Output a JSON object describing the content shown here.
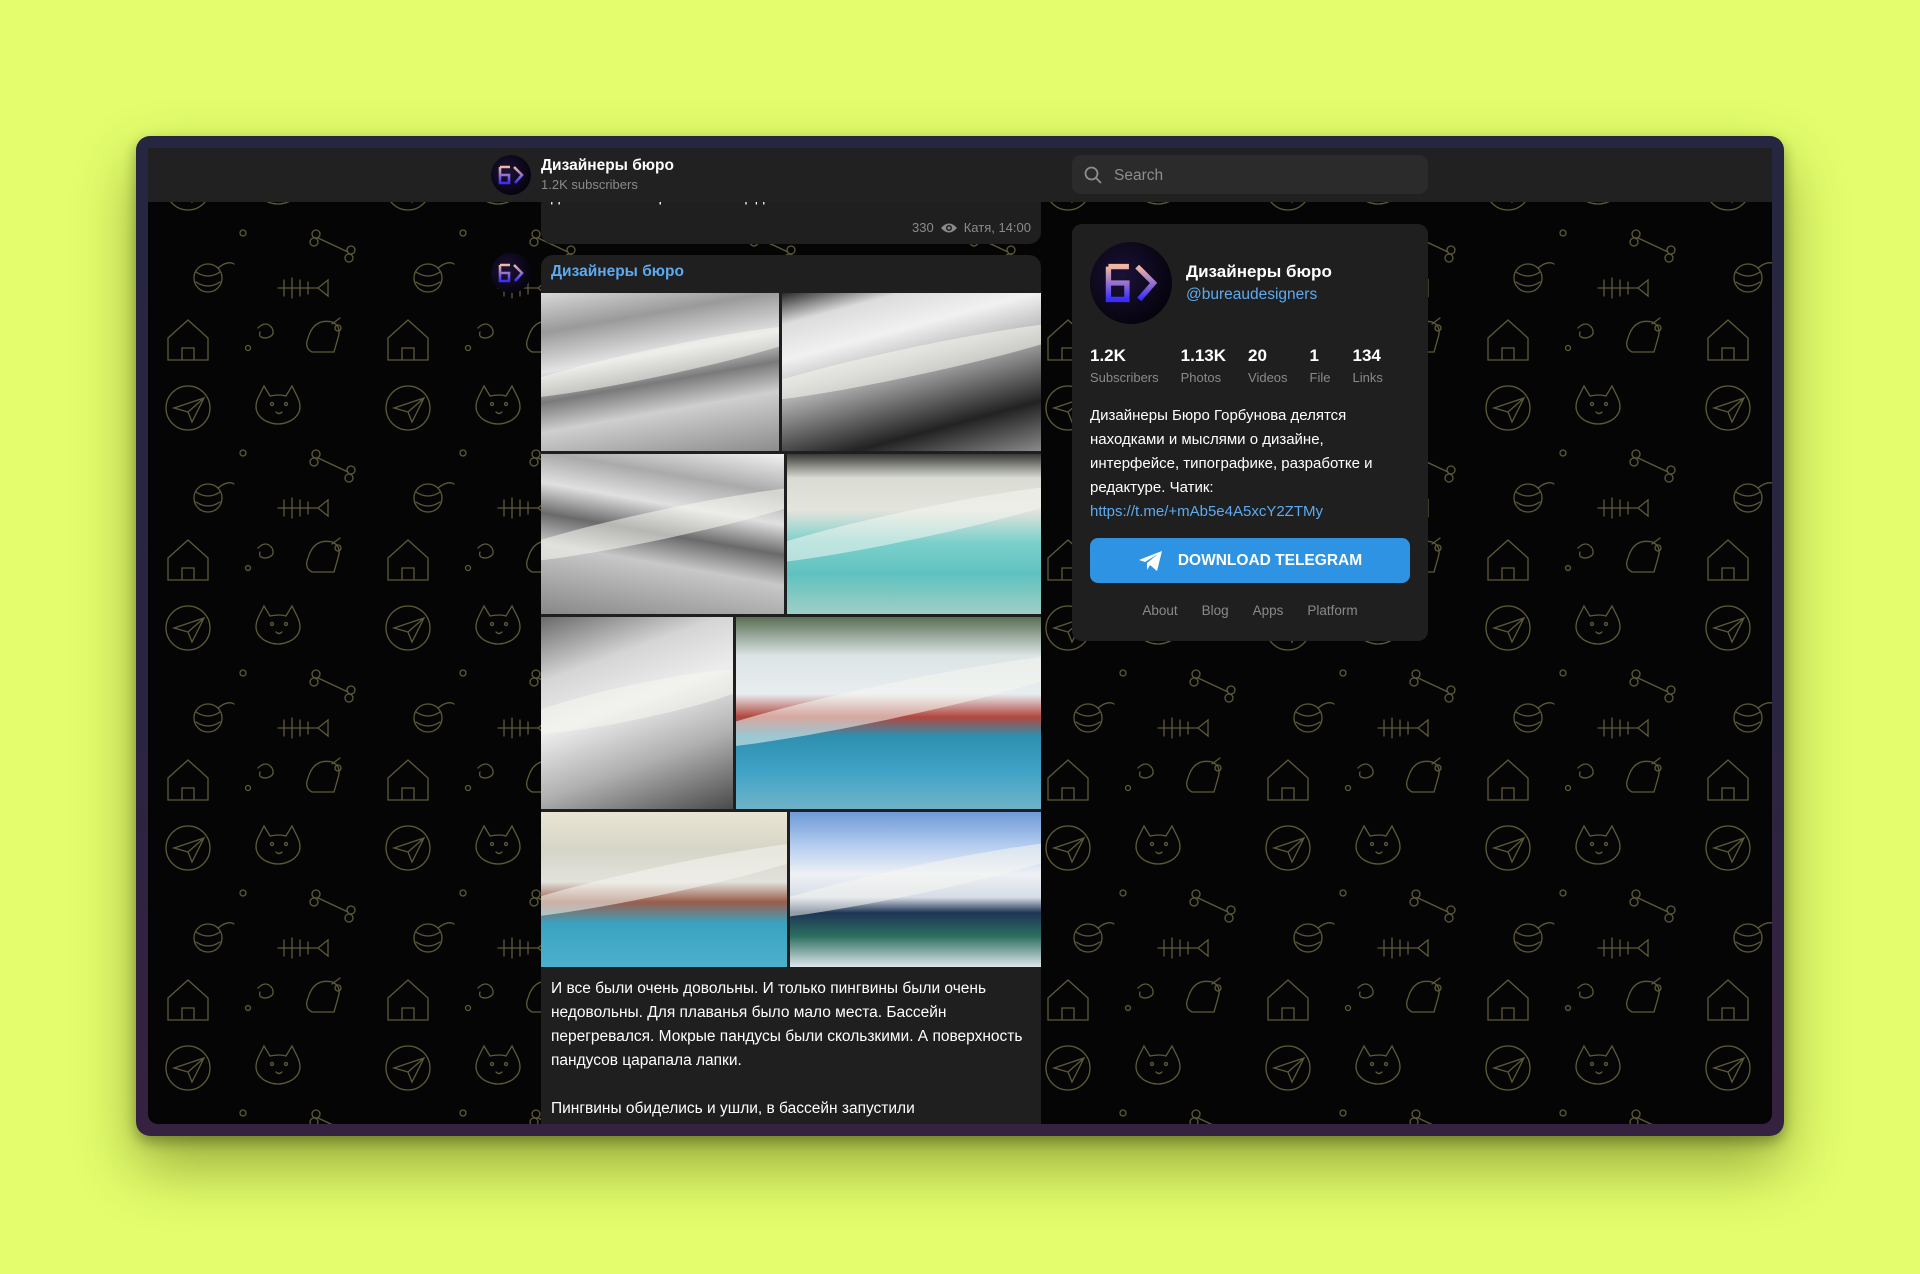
{
  "header": {
    "channel_name": "Дизайнеры бюро",
    "subscribers": "1.2K subscribers",
    "search_placeholder": "Search"
  },
  "previous_message": {
    "text": "добавили смотровые площадки.",
    "views": "330",
    "signature": "Катя, 14:00"
  },
  "message": {
    "author": "Дизайнеры бюро",
    "photos": [
      {
        "label": "penguin-pool-bw-1"
      },
      {
        "label": "penguin-pool-bw-2"
      },
      {
        "label": "penguin-pool-bw-3"
      },
      {
        "label": "penguin-pool-color-1"
      },
      {
        "label": "penguin-pool-bw-4"
      },
      {
        "label": "fashion-shoot-1"
      },
      {
        "label": "fashion-shoot-2"
      },
      {
        "label": "pool-render"
      }
    ],
    "paragraphs": [
      "И все были очень довольны. И только пингвины были очень недовольны. Для плаванья было мало места. Бассейн перегревался. Мокрые пандусы были скользкими. А поверхность пандусов царапала лапки.",
      "Пингвины обиделись и ушли, в бассейн запустили"
    ]
  },
  "channel_panel": {
    "title": "Дизайнеры бюро",
    "username": "@bureaudesigners",
    "stats": [
      {
        "value": "1.2K",
        "label": "Subscribers"
      },
      {
        "value": "1.13K",
        "label": "Photos"
      },
      {
        "value": "20",
        "label": "Videos"
      },
      {
        "value": "1",
        "label": "File"
      },
      {
        "value": "134",
        "label": "Links"
      }
    ],
    "description": "Дизайнеры Бюро Горбунова делятся находками и мыслями о дизайне, интерфейсе, типографике, разработке и редактуре. Чатик:",
    "chat_link": "https://t.me/+mAb5e4A5xcY2ZTMy",
    "download_button": "DOWNLOAD TELEGRAM",
    "footer_links": [
      "About",
      "Blog",
      "Apps",
      "Platform"
    ]
  },
  "colors": {
    "page_background": "#e3fd6c",
    "accent_blue": "#2d93e2",
    "link_blue": "#5eaaf0",
    "bubble": "#1f1f1f",
    "pattern_stroke": "#5c5a36"
  }
}
